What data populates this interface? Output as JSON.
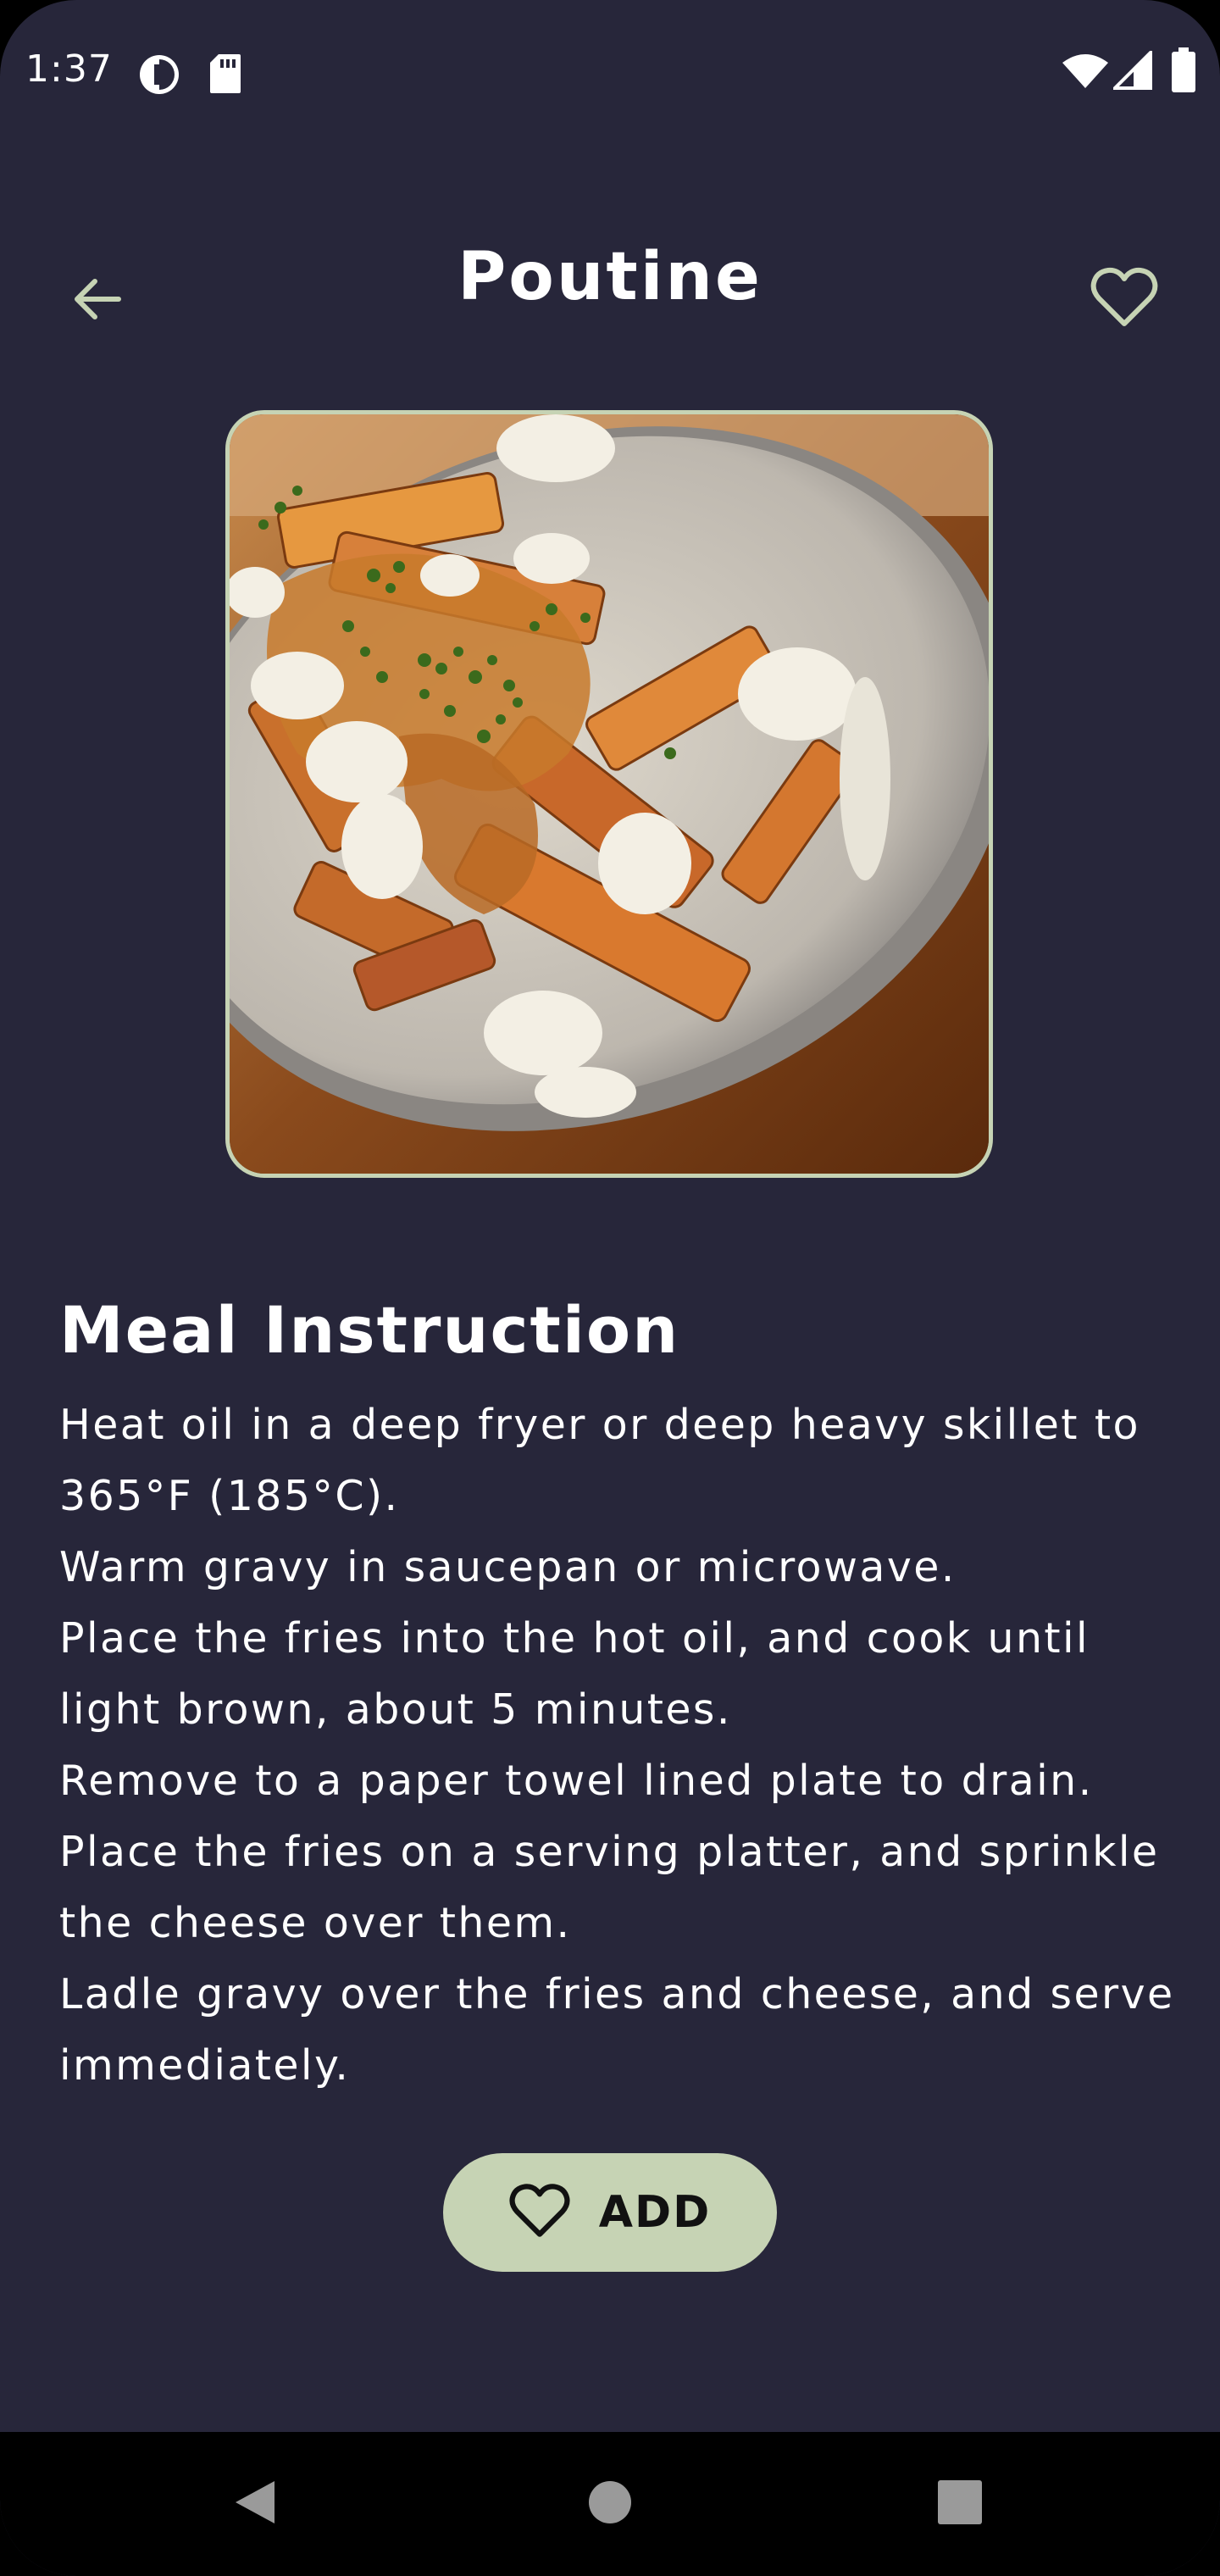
{
  "status_bar": {
    "time": "1:37",
    "icons": [
      "data-saver-icon",
      "sd-card-icon",
      "wifi-icon",
      "signal-icon",
      "battery-icon"
    ]
  },
  "header": {
    "title": "Poutine",
    "back_icon": "arrow-left-icon",
    "favorite_icon": "heart-outline-icon"
  },
  "meal": {
    "image_description_icon": "poutine-photo"
  },
  "instructions": {
    "heading": "Meal Instruction",
    "text": "Heat oil in a deep fryer or deep heavy skillet to 365°F (185°C).\nWarm gravy in saucepan or microwave.\nPlace the fries into the hot oil, and cook until light brown, about 5 minutes.\nRemove to a paper towel lined plate to drain.\nPlace the fries on a serving platter, and sprinkle the cheese over them.\nLadle gravy over the fries and cheese, and serve immediately."
  },
  "add_button": {
    "label": "ADD",
    "icon": "heart-outline-icon"
  },
  "nav_bar": {
    "items": [
      "back-triangle-icon",
      "home-circle-icon",
      "recents-square-icon"
    ]
  },
  "colors": {
    "background": "#27263a",
    "accent": "#c6d3b4",
    "text": "#ffffff"
  }
}
